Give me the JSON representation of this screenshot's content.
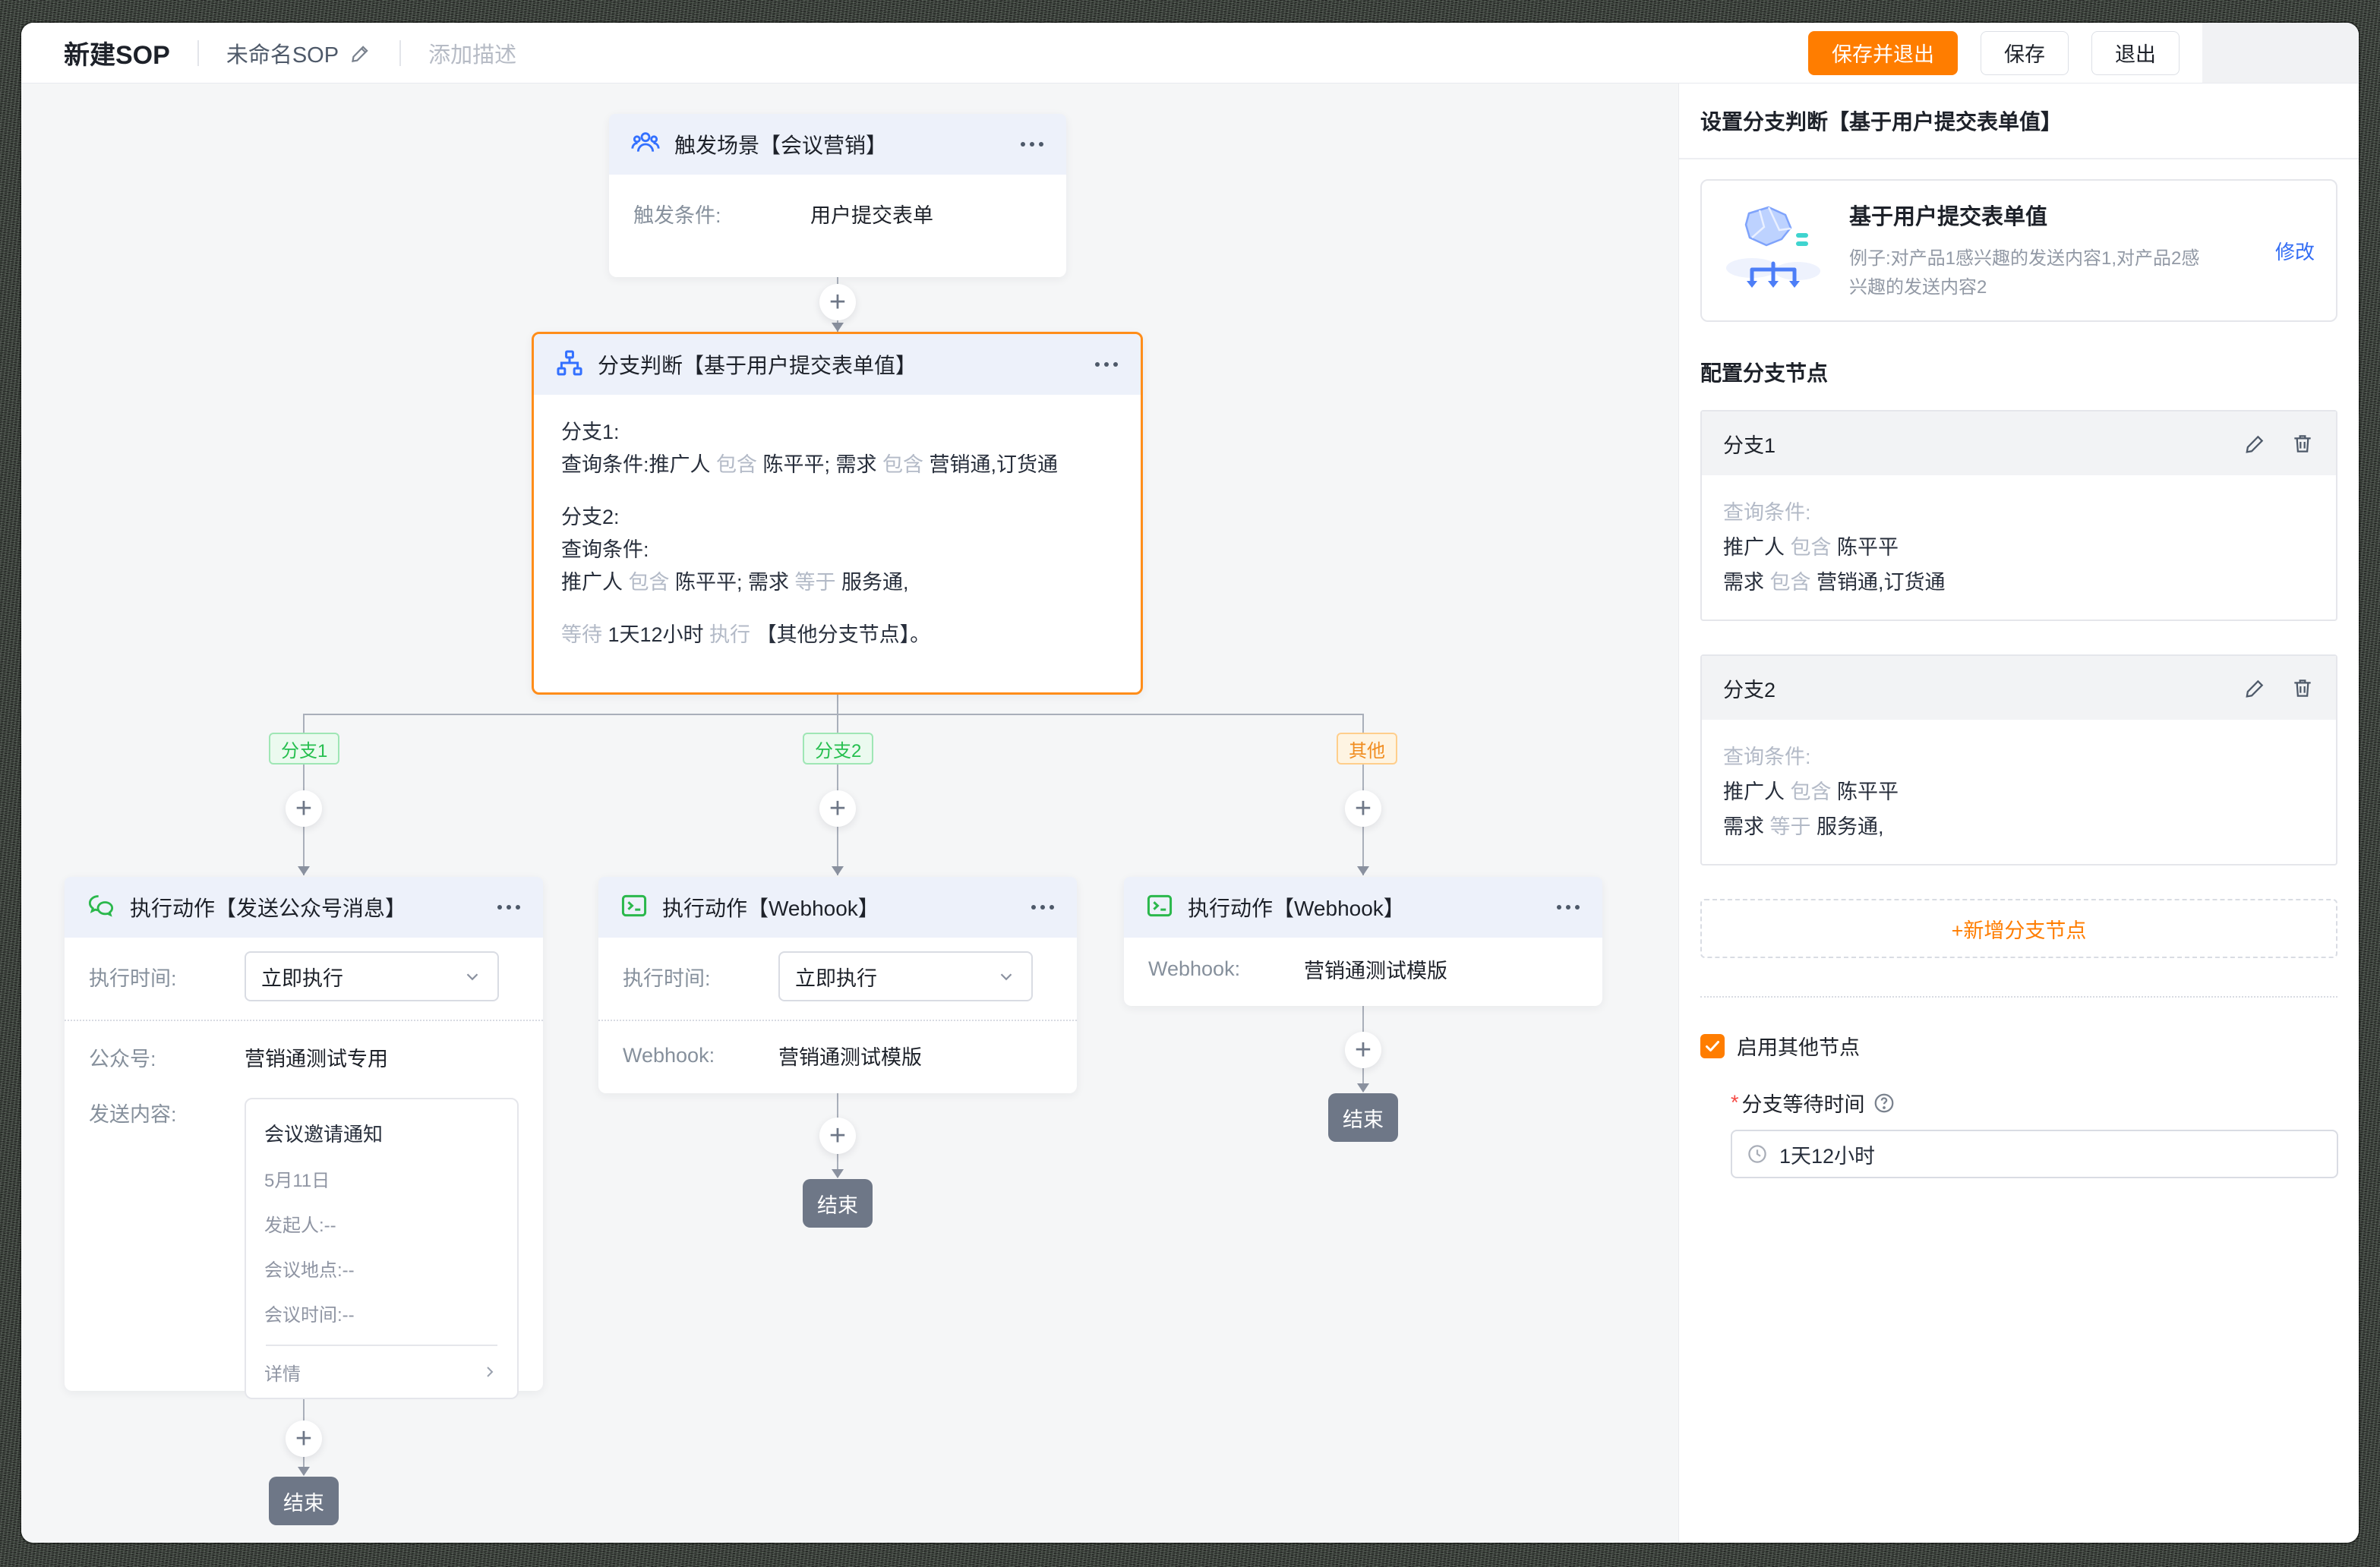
{
  "colors": {
    "accent": "#FF7D00",
    "blue": "#3370FF",
    "link": "#336DF4",
    "green": "#2BB84C",
    "dark": "#1D2129",
    "grey": "#86909C",
    "muted": "#B3BAC7",
    "endbg": "#6E7787",
    "canvasbg": "#F5F6F7",
    "chip_green": "#26BF4F",
    "chip_orange": "#F08C1F",
    "red": "#F54A45"
  },
  "header": {
    "title": "新建SOP",
    "doc_name": "未命名SOP",
    "add_desc": "添加描述",
    "save_exit": "保存并退出",
    "save": "保存",
    "exit": "退出"
  },
  "canvas": {
    "end_label": "结束",
    "trigger": {
      "title": "触发场景【会议营销】",
      "cond_label": "触发条件:",
      "cond_value": "用户提交表单"
    },
    "branch": {
      "title": "分支判断【基于用户提交表单值】",
      "lines": [
        [
          {
            "t": "分支1:"
          }
        ],
        [
          {
            "t": "查询条件:推广人 "
          },
          {
            "t": "包含",
            "m": 1
          },
          {
            "t": " 陈平平; 需求 "
          },
          {
            "t": "包含",
            "m": 1
          },
          {
            "t": " 营销通,订货通"
          }
        ],
        [],
        [
          {
            "t": "分支2:"
          }
        ],
        [
          {
            "t": "查询条件:"
          }
        ],
        [
          {
            "t": "推广人 "
          },
          {
            "t": "包含",
            "m": 1
          },
          {
            "t": " 陈平平; 需求 "
          },
          {
            "t": "等于",
            "m": 1
          },
          {
            "t": " 服务通,"
          }
        ],
        [],
        [
          {
            "t": "等待",
            "m": 1
          },
          {
            "t": " 1天12小时 "
          },
          {
            "t": "执行",
            "m": 1
          },
          {
            "t": " 【其他分支节点】。"
          }
        ]
      ]
    },
    "branch_labels": [
      {
        "text": "分支1"
      },
      {
        "text": "分支2"
      },
      {
        "text": "其他"
      }
    ],
    "action1": {
      "title": "执行动作【发送公众号消息】",
      "exec_label": "执行时间:",
      "exec_value": "立即执行",
      "account_label": "公众号:",
      "account_value": "营销通测试专用",
      "content_label": "发送内容:",
      "card": {
        "title": "会议邀请通知",
        "date": "5月11日",
        "row1": "发起人:--",
        "row2": "会议地点:--",
        "row3": "会议时间:--",
        "detail": "详情"
      }
    },
    "action2": {
      "title": "执行动作【Webhook】",
      "exec_label": "执行时间:",
      "exec_value": "立即执行",
      "webhook_label": "Webhook:",
      "webhook_value": "营销通测试模版"
    },
    "action3": {
      "title": "执行动作【Webhook】",
      "webhook_label": "Webhook:",
      "webhook_value": "营销通测试模版"
    }
  },
  "panel": {
    "title": "设置分支判断【基于用户提交表单值】",
    "info_card": {
      "title": "基于用户提交表单值",
      "desc": "例子:对产品1感兴趣的发送内容1,对产品2感兴趣的发送内容2",
      "modify": "修改"
    },
    "config_heading": "配置分支节点",
    "branches": [
      {
        "name": "分支1",
        "lines": [
          [
            {
              "t": "查询条件:",
              "m": 1
            }
          ],
          [
            {
              "t": "推广人 "
            },
            {
              "t": "包含",
              "m": 1
            },
            {
              "t": " 陈平平"
            }
          ],
          [
            {
              "t": "需求 "
            },
            {
              "t": "包含",
              "m": 1
            },
            {
              "t": " 营销通,订货通"
            }
          ]
        ]
      },
      {
        "name": "分支2",
        "lines": [
          [
            {
              "t": "查询条件:",
              "m": 1
            }
          ],
          [
            {
              "t": "推广人 "
            },
            {
              "t": "包含",
              "m": 1
            },
            {
              "t": " 陈平平"
            }
          ],
          [
            {
              "t": "需求 "
            },
            {
              "t": "等于",
              "m": 1
            },
            {
              "t": " 服务通,"
            }
          ]
        ]
      }
    ],
    "add_branch": "+新增分支节点",
    "enable_other": "启用其他节点",
    "wait_label": "分支等待时间",
    "wait_value": "1天12小时"
  }
}
